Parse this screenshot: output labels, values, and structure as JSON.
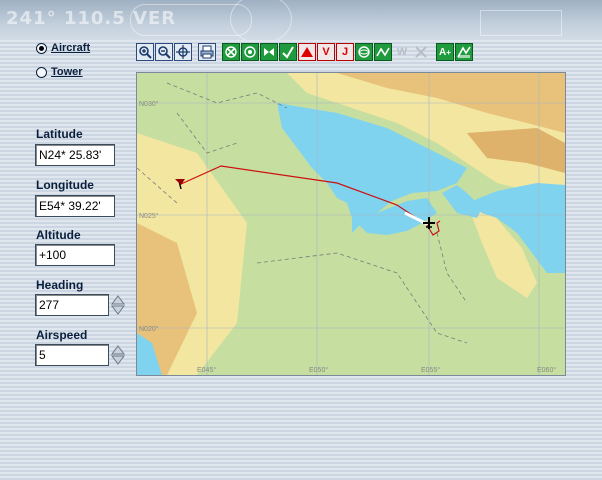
{
  "banner": {
    "text": "241° 110.5 VER"
  },
  "view_mode": {
    "aircraft_label": "Aircraft",
    "tower_label": "Tower",
    "selected": "aircraft"
  },
  "fields": {
    "latitude": {
      "label": "Latitude",
      "value": "N24* 25.83'"
    },
    "longitude": {
      "label": "Longitude",
      "value": "E54* 39.22'"
    },
    "altitude": {
      "label": "Altitude",
      "value": "+100"
    },
    "heading": {
      "label": "Heading",
      "value": "277"
    },
    "airspeed": {
      "label": "Airspeed",
      "value": "5"
    }
  },
  "toolbar": {
    "zoom_in": "zoom-in-icon",
    "zoom_out": "zoom-out-icon",
    "center": "center-target-icon",
    "print": "printer-icon",
    "v_label": "V",
    "j_label": "J",
    "w_label": "W",
    "label_tool": "A"
  },
  "map": {
    "grid_labels": {
      "n030": "N030°",
      "n025": "N025°",
      "n020": "N020°",
      "e045": "E045°",
      "e050": "E050°",
      "e055": "E055°",
      "e060": "E060°"
    }
  },
  "colors": {
    "water": "#7fd3ef",
    "land_low": "#c6dfa0",
    "land_mid": "#f2e6a0",
    "land_high": "#e8c27a",
    "route": "#cc1111",
    "accent": "#1f9a3c"
  }
}
